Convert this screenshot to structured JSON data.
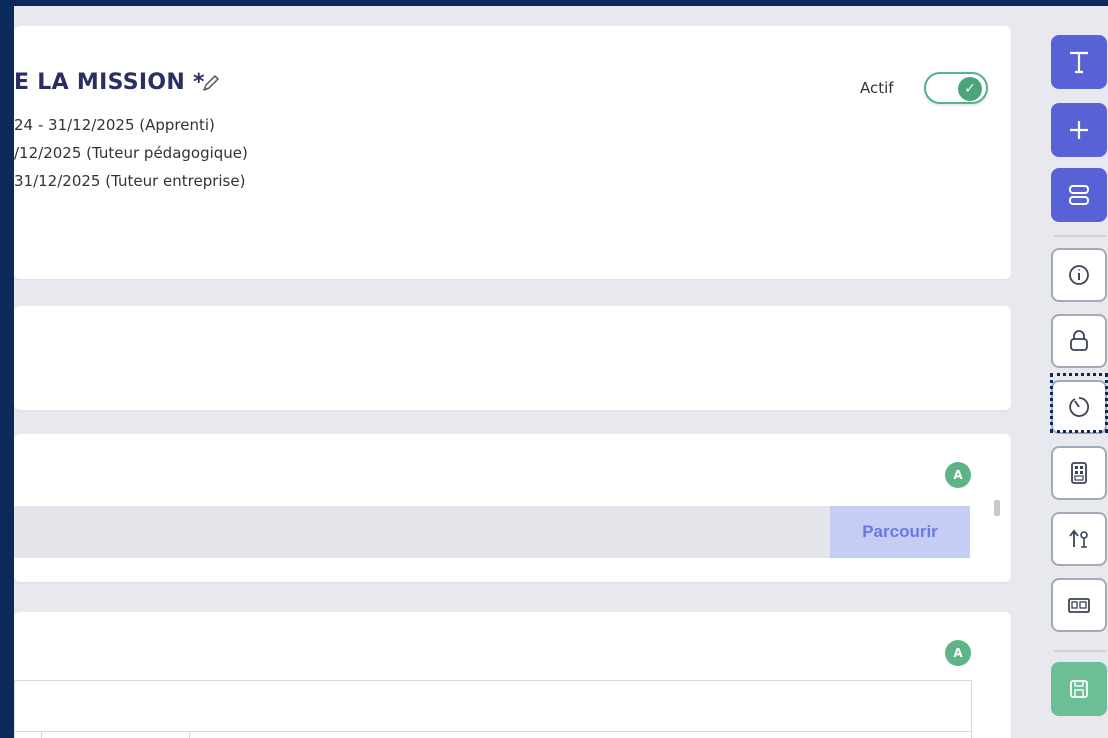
{
  "mission": {
    "title": "E LA MISSION *",
    "lines": [
      "24 - 31/12/2025 (Apprenti)",
      "/12/2025 (Tuteur pédagogique)",
      "31/12/2025 (Tuteur entreprise)"
    ],
    "status_label": "Actif",
    "status_on": true
  },
  "attachment": {
    "badge": "A",
    "browse_label": "Parcourir"
  },
  "table_section": {
    "badge": "A"
  },
  "toolbar": {
    "items": [
      {
        "name": "text-tool",
        "icon": "text-icon",
        "style": "solid"
      },
      {
        "name": "add-tool",
        "icon": "plus-icon",
        "style": "solid"
      },
      {
        "name": "layout-tool",
        "icon": "rows-icon",
        "style": "solid"
      },
      {
        "name": "info-tool",
        "icon": "info-icon",
        "style": "outline"
      },
      {
        "name": "lock-tool",
        "icon": "lock-icon",
        "style": "outline"
      },
      {
        "name": "timer-tool",
        "icon": "timer-icon",
        "style": "outline"
      },
      {
        "name": "calculator-tool",
        "icon": "calculator-icon",
        "style": "outline"
      },
      {
        "name": "sort-tool",
        "icon": "sort-icon",
        "style": "outline"
      },
      {
        "name": "id-card-tool",
        "icon": "id-card-icon",
        "style": "outline"
      },
      {
        "name": "save-tool",
        "icon": "save-icon",
        "style": "save"
      }
    ]
  },
  "colors": {
    "frame": "#0a2a5c",
    "primary": "#5961d6",
    "success": "#5cb487",
    "browse_bg": "#c6cdf4"
  }
}
